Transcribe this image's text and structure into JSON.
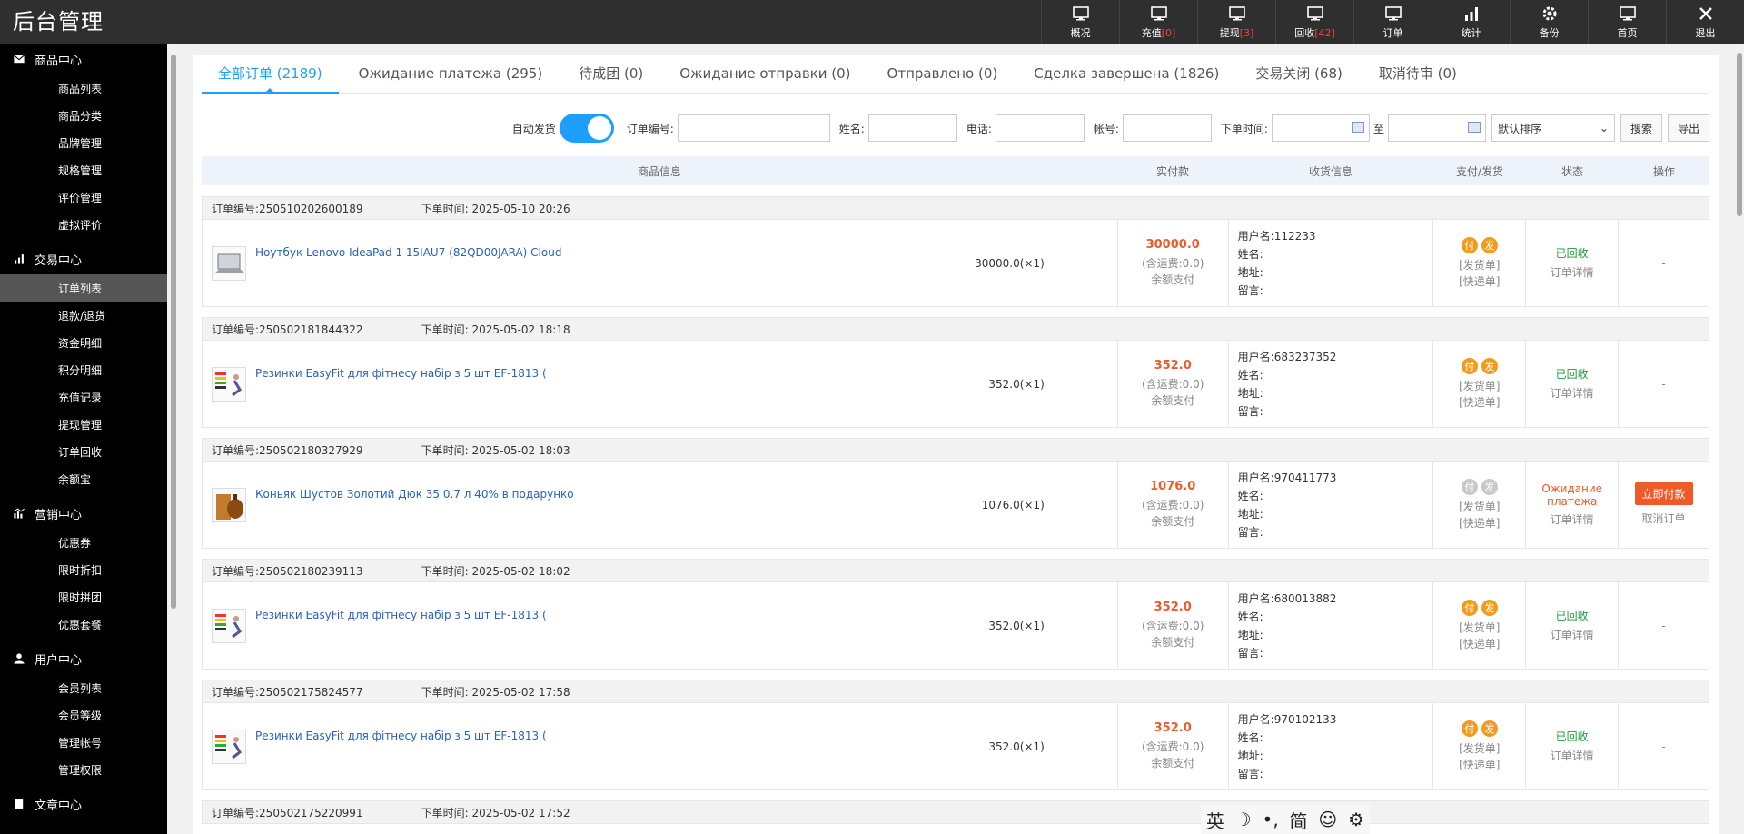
{
  "app_title": "后台管理",
  "topnav": [
    {
      "label": "概况",
      "count": "",
      "icon": "monitor-icon"
    },
    {
      "label": "充值",
      "count": "[0]",
      "icon": "monitor-icon"
    },
    {
      "label": "提现",
      "count": "[3]",
      "icon": "monitor-icon"
    },
    {
      "label": "回收",
      "count": "[42]",
      "icon": "monitor-icon"
    },
    {
      "label": "订单",
      "count": "",
      "icon": "monitor-icon"
    },
    {
      "label": "统计",
      "count": "",
      "icon": "bar-chart-icon"
    },
    {
      "label": "备份",
      "count": "",
      "icon": "gear-icon"
    },
    {
      "label": "首页",
      "count": "",
      "icon": "monitor-icon"
    },
    {
      "label": "退出",
      "count": "",
      "icon": "close-icon"
    }
  ],
  "sidebar": {
    "sections": [
      {
        "title": "商品中心",
        "icon": "mail-icon",
        "items": [
          "商品列表",
          "商品分类",
          "品牌管理",
          "规格管理",
          "评价管理",
          "虚拟评价"
        ]
      },
      {
        "title": "交易中心",
        "icon": "bar-chart-icon",
        "items": [
          "订单列表",
          "退款/退货",
          "资金明细",
          "积分明细",
          "充值记录",
          "提现管理",
          "订单回收",
          "余额宝"
        ]
      },
      {
        "title": "营销中心",
        "icon": "chart-icon",
        "items": [
          "优惠券",
          "限时折扣",
          "限时拼团",
          "优惠套餐"
        ]
      },
      {
        "title": "用户中心",
        "icon": "user-icon",
        "items": [
          "会员列表",
          "会员等级",
          "管理帐号",
          "管理权限"
        ]
      },
      {
        "title": "文章中心",
        "icon": "doc-icon",
        "items": []
      }
    ],
    "active_item": "订单列表"
  },
  "tabs": [
    "全部订单 (2189)",
    "Ожидание платежа (295)",
    "待成团 (0)",
    "Ожидание отправки (0)",
    "Отправлено (0)",
    "Сделка завершена (1826)",
    "交易关闭 (68)",
    "取消待审 (0)"
  ],
  "filters": {
    "auto_ship_label": "自动发货",
    "auto_ship_on": true,
    "order_no_label": "订单编号:",
    "name_label": "姓名:",
    "phone_label": "电话:",
    "account_label": "帐号:",
    "time_label": "下单时间:",
    "to_label": "至",
    "sort_value": "默认排序",
    "search_btn": "搜索",
    "export_btn": "导出"
  },
  "table_headers": [
    "商品信息",
    "实付款",
    "收货信息",
    "支付/发货",
    "状态",
    "操作"
  ],
  "order_labels": {
    "order_no": "订单编号:",
    "order_time": "下单时间:",
    "shipping_incl": "(含运费:0.0)",
    "pay_method": "余额支付",
    "username": "用户名:",
    "name": "姓名:",
    "address": "地址:",
    "message": "留言:",
    "pay_dot": "付",
    "ship_dot": "发",
    "ship_doc": "[发货单]",
    "express_doc": "[快递单]",
    "detail": "订单详情"
  },
  "orders": [
    {
      "no": "250510202600189",
      "time": "2025-05-10 20:26",
      "product": "Ноутбук Lenovo IdeaPad 1 15IAU7 (82QD00JARA) Cloud",
      "qty": "30000.0(×1)",
      "amount": "30000.0",
      "user": "112233",
      "status": "已回收",
      "status_color": "green",
      "paid": true,
      "op": "-",
      "cancel": "",
      "thumb": "laptop"
    },
    {
      "no": "250502181844322",
      "time": "2025-05-02 18:18",
      "product": "Резинки EasyFit для фітнесу набір з 5 шт EF-1813 (",
      "qty": "352.0(×1)",
      "amount": "352.0",
      "user": "683237352",
      "status": "已回收",
      "status_color": "green",
      "paid": true,
      "op": "-",
      "cancel": "",
      "thumb": "bands"
    },
    {
      "no": "250502180327929",
      "time": "2025-05-02 18:03",
      "product": "Коньяк Шустов Золотий Дюк 35 0.7 л 40% в подарунко",
      "qty": "1076.0(×1)",
      "amount": "1076.0",
      "user": "970411773",
      "status": "Ожидание платежа",
      "status_color": "orange",
      "paid": false,
      "op": "立即付款",
      "cancel": "取消订单",
      "thumb": "cognac"
    },
    {
      "no": "250502180239113",
      "time": "2025-05-02 18:02",
      "product": "Резинки EasyFit для фітнесу набір з 5 шт EF-1813 (",
      "qty": "352.0(×1)",
      "amount": "352.0",
      "user": "680013882",
      "status": "已回收",
      "status_color": "green",
      "paid": true,
      "op": "-",
      "cancel": "",
      "thumb": "bands"
    },
    {
      "no": "250502175824577",
      "time": "2025-05-02 17:58",
      "product": "Резинки EasyFit для фітнесу набір з 5 шт EF-1813 (",
      "qty": "352.0(×1)",
      "amount": "352.0",
      "user": "970102133",
      "status": "已回收",
      "status_color": "green",
      "paid": true,
      "op": "-",
      "cancel": "",
      "thumb": "bands"
    },
    {
      "no": "250502175220991",
      "time": "2025-05-02 17:52",
      "product": "",
      "qty": "",
      "amount": "",
      "user": "",
      "status": "",
      "status_color": "green",
      "paid": true,
      "op": "",
      "cancel": "",
      "thumb": ""
    }
  ],
  "ime_bar": [
    "英",
    "☽",
    "•,",
    "简",
    "☺",
    "⚙"
  ]
}
